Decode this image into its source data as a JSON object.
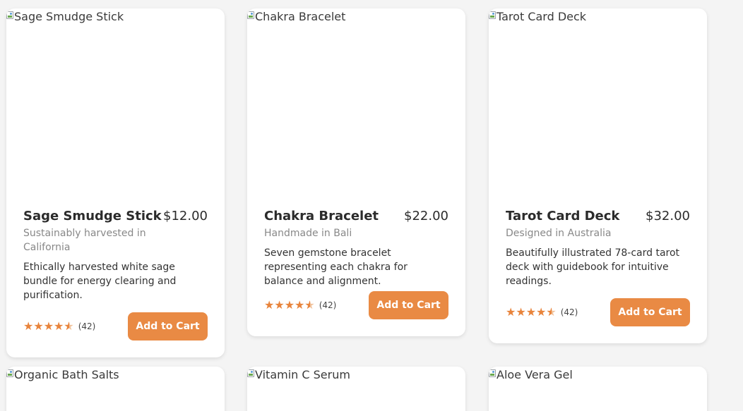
{
  "products": [
    {
      "image_alt": "Sage Smudge Stick",
      "title": "Sage Smudge Stick",
      "price": "$12.00",
      "origin": "Sustainably harvested in California",
      "description": "Ethically harvested white sage bundle for energy clearing and purification.",
      "rating": 4.5,
      "review_count": "(42)",
      "button_label": "Add to Cart"
    },
    {
      "image_alt": "Chakra Bracelet",
      "title": "Chakra Bracelet",
      "price": "$22.00",
      "origin": "Handmade in Bali",
      "description": "Seven gemstone bracelet representing each chakra for balance and alignment.",
      "rating": 4.5,
      "review_count": "(42)",
      "button_label": "Add to Cart"
    },
    {
      "image_alt": "Tarot Card Deck",
      "title": "Tarot Card Deck",
      "price": "$32.00",
      "origin": "Designed in Australia",
      "description": "Beautifully illustrated 78-card tarot deck with guidebook for intuitive readings.",
      "rating": 4.5,
      "review_count": "(42)",
      "button_label": "Add to Cart"
    },
    {
      "image_alt": "Organic Bath Salts"
    },
    {
      "image_alt": "Vitamin C Serum"
    },
    {
      "image_alt": "Aloe Vera Gel"
    }
  ],
  "colors": {
    "accent": "#e98a44",
    "star": "#e8843c",
    "background": "#f4f4f4"
  }
}
